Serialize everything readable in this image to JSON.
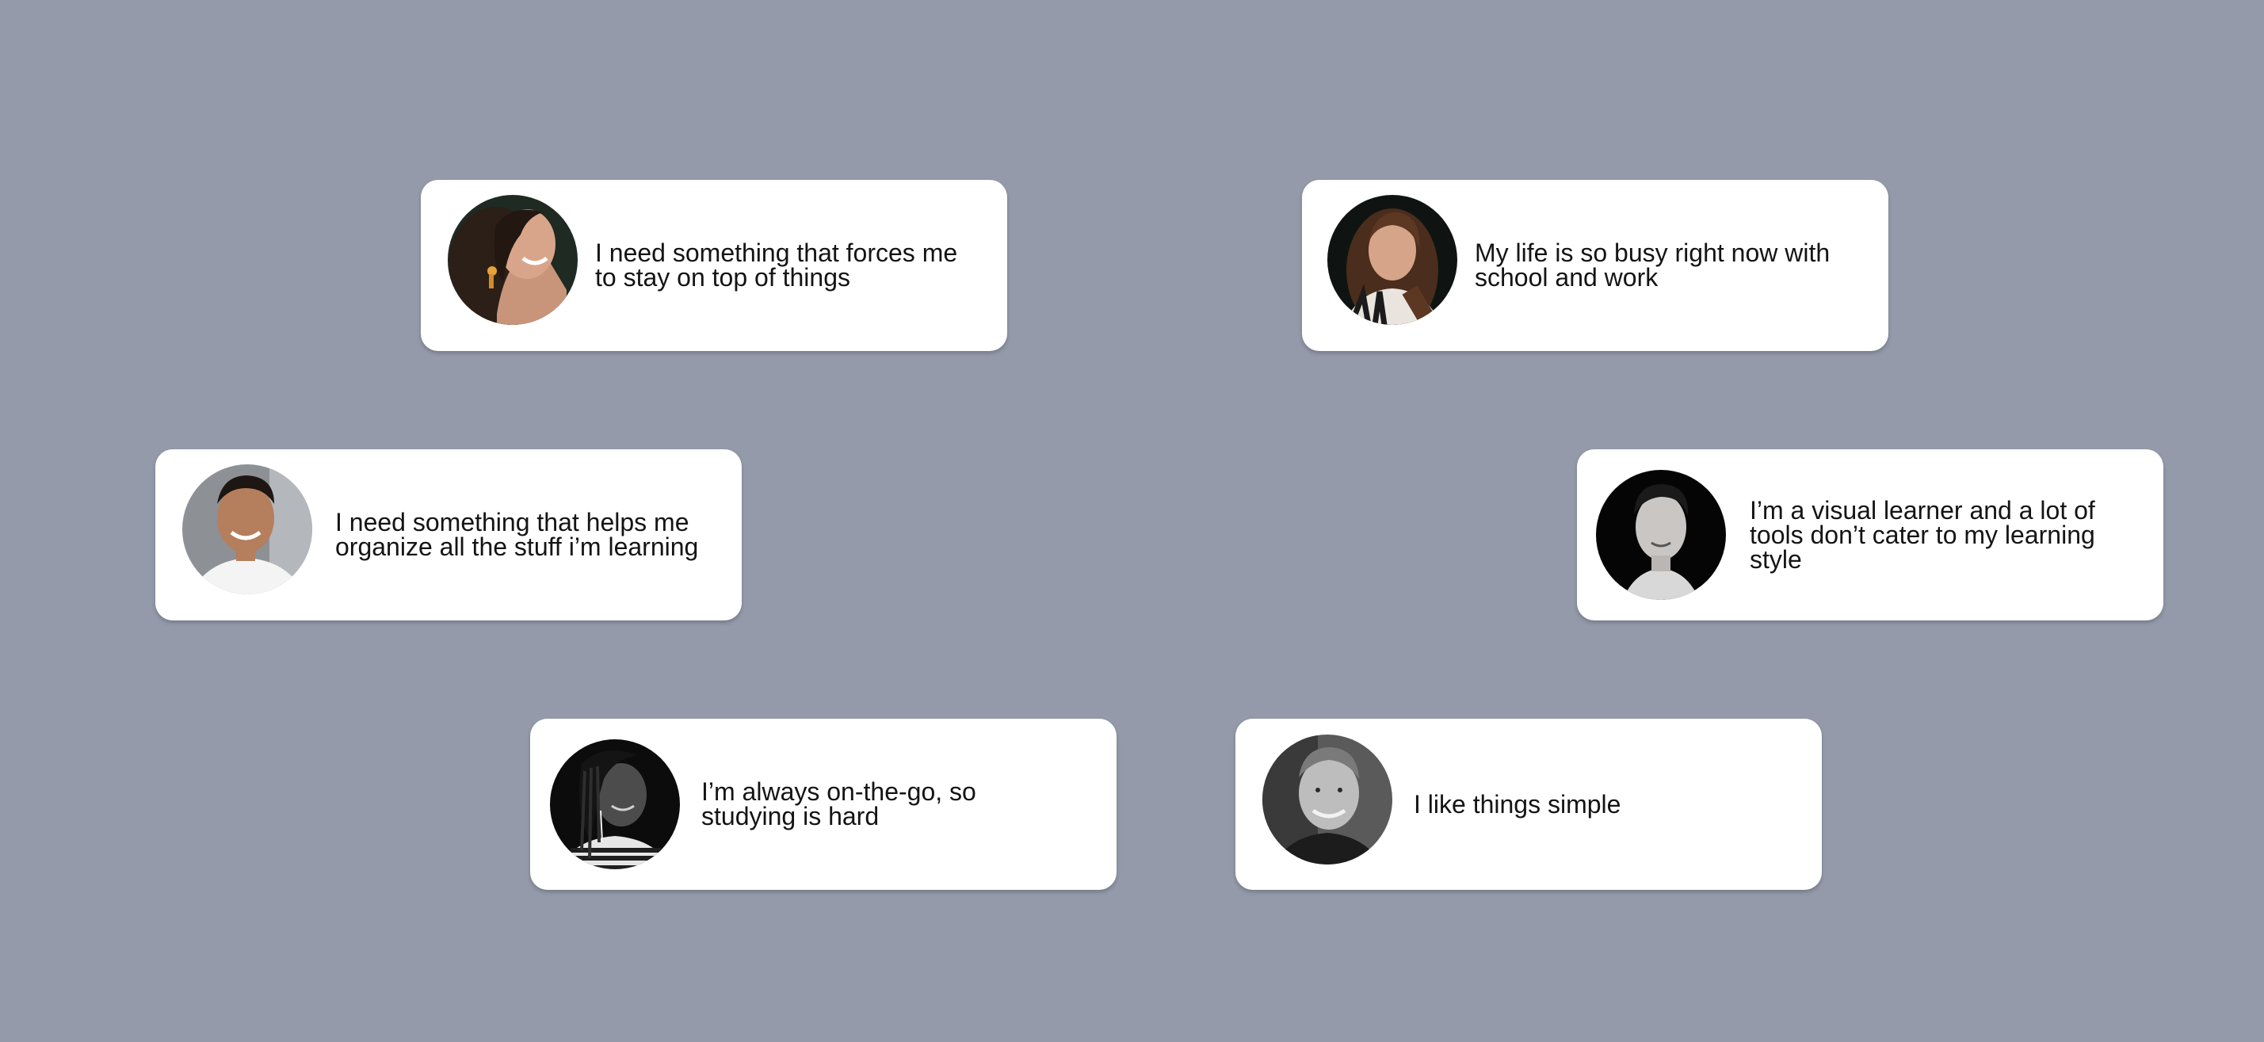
{
  "testimonials": [
    {
      "id": "c1",
      "quote": "I need something that forces me to stay on top of things",
      "lines": [
        "I need something that forces me",
        "to stay on top of things"
      ],
      "avatar_icon": "woman-laughing-avatar"
    },
    {
      "id": "c2",
      "quote": "My life is so busy right now with school and work",
      "lines": [
        "My life is so busy right now with",
        "school and work"
      ],
      "avatar_icon": "woman-long-hair-avatar"
    },
    {
      "id": "c3",
      "quote": "I need something that helps me organize all the stuff i’m learning",
      "lines": [
        "I need something that helps me",
        "organize all the stuff i’m learning"
      ],
      "avatar_icon": "man-smiling-avatar"
    },
    {
      "id": "c4",
      "quote": "I’m a visual learner and a lot of tools don’t cater to my learning style",
      "lines": [
        "I’m a visual learner and a lot of",
        "tools don’t cater to my learning",
        "style"
      ],
      "avatar_icon": "man-dark-background-avatar"
    },
    {
      "id": "c5",
      "quote": "I’m always on-the-go, so studying is hard",
      "lines": [
        "I’m always on-the-go, so",
        "studying is hard"
      ],
      "avatar_icon": "woman-earphones-avatar"
    },
    {
      "id": "c6",
      "quote": "I like things simple",
      "lines": [
        "I like things simple"
      ],
      "avatar_icon": "man-grayscale-avatar"
    }
  ],
  "colors": {
    "background": "#949aa9",
    "card": "#ffffff",
    "text": "#141414"
  }
}
